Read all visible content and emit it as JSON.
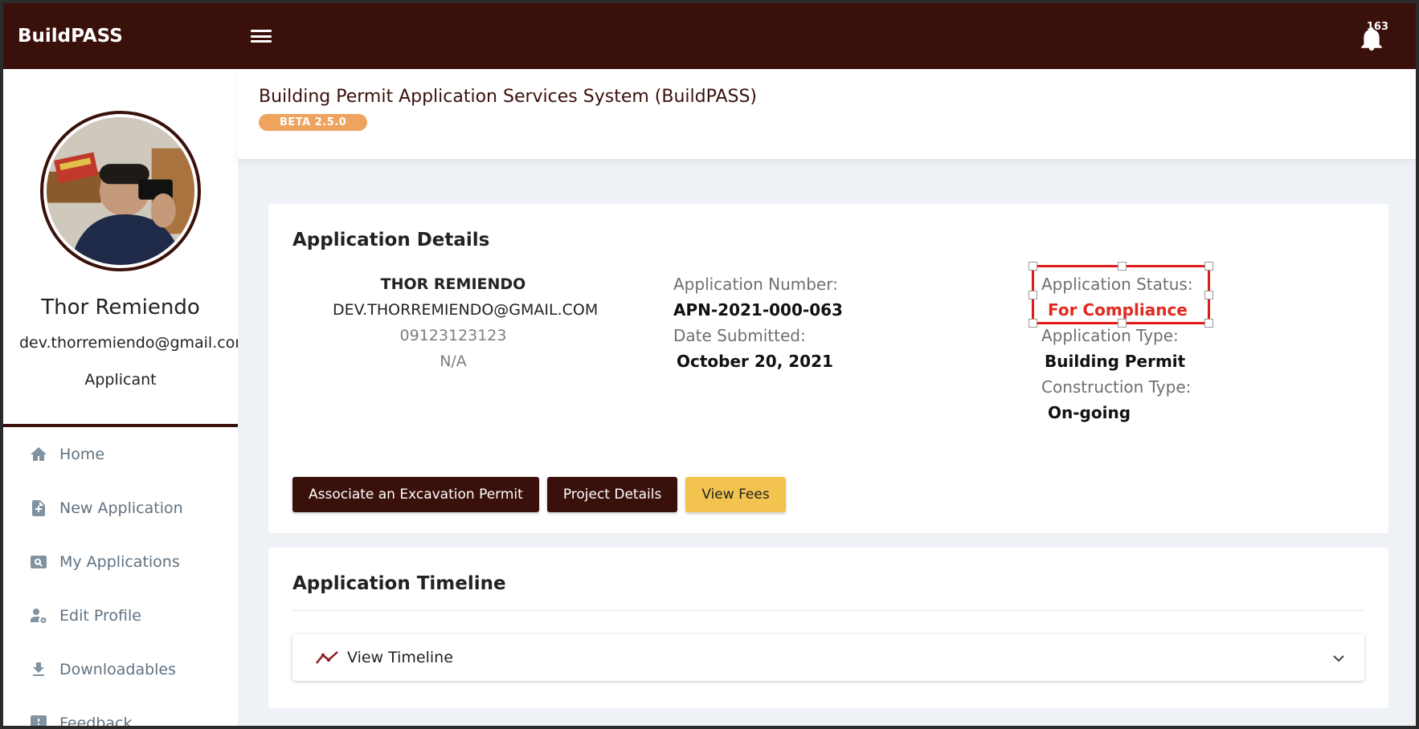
{
  "topbar": {
    "brand": "BuildPASS",
    "notification_count": "163"
  },
  "sidebar": {
    "user_name": "Thor Remiendo",
    "user_email": "dev.thorremiendo@gmail.com",
    "user_role": "Applicant",
    "items": [
      {
        "label": "Home",
        "icon": "home-icon"
      },
      {
        "label": "New Application",
        "icon": "new-file-icon"
      },
      {
        "label": "My Applications",
        "icon": "search-file-icon"
      },
      {
        "label": "Edit Profile",
        "icon": "user-gear-icon"
      },
      {
        "label": "Downloadables",
        "icon": "download-icon"
      },
      {
        "label": "Feedback",
        "icon": "feedback-icon"
      }
    ]
  },
  "header": {
    "title": "Building Permit Application Services System (BuildPASS)",
    "version_badge": "BETA 2.5.0"
  },
  "details": {
    "title": "Application Details",
    "applicant": {
      "name": "THOR REMIENDO",
      "email": "DEV.THORREMIENDO@GMAIL.COM",
      "phone": "09123123123",
      "other": "N/A"
    },
    "application_number_label": "Application Number:",
    "application_number": "APN-2021-000-063",
    "date_submitted_label": "Date Submitted:",
    "date_submitted": "October 20, 2021",
    "status_label": "Application Status:",
    "status_value": "For Compliance",
    "type_label": "Application Type:",
    "type_value": "Building Permit",
    "construction_label": "Construction Type:",
    "construction_value": "On-going",
    "buttons": {
      "associate": "Associate an Excavation Permit",
      "project": "Project Details",
      "fees": "View Fees"
    }
  },
  "timeline": {
    "title": "Application Timeline",
    "toggle_label": "View Timeline"
  },
  "colors": {
    "brand": "#3a100b",
    "accent_yellow": "#f2c44f",
    "status_red": "#e12a1f",
    "badge_orange": "#eea35e"
  }
}
